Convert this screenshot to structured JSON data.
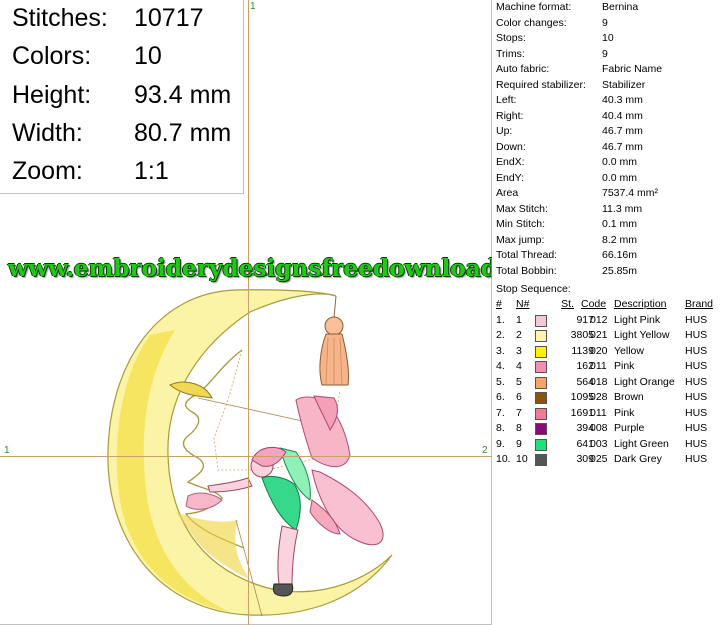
{
  "stats": [
    {
      "label": "Stitches:",
      "value": "10717"
    },
    {
      "label": "Colors:",
      "value": "10"
    },
    {
      "label": "Height:",
      "value": "93.4 mm"
    },
    {
      "label": "Width:",
      "value": "80.7 mm"
    },
    {
      "label": "Zoom:",
      "value": "1:1"
    }
  ],
  "guides": {
    "h_left": "1",
    "h_right": "2",
    "v_top": "1"
  },
  "watermark": "www.embroiderydesignsfreedownload.com",
  "info": [
    {
      "key": "Machine format:",
      "value": "Bernina"
    },
    {
      "key": "Color changes:",
      "value": "9"
    },
    {
      "key": "Stops:",
      "value": "10"
    },
    {
      "key": "Trims:",
      "value": "9"
    },
    {
      "key": "Auto fabric:",
      "value": "Fabric Name"
    },
    {
      "key": "Required stabilizer:",
      "value": "Stabilizer"
    },
    {
      "key": "Left:",
      "value": "40.3 mm"
    },
    {
      "key": "Right:",
      "value": "40.4 mm"
    },
    {
      "key": "Up:",
      "value": "46.7 mm"
    },
    {
      "key": "Down:",
      "value": "46.7 mm"
    },
    {
      "key": "EndX:",
      "value": "0.0 mm"
    },
    {
      "key": "EndY:",
      "value": "0.0 mm"
    },
    {
      "key": "Area",
      "value": "7537.4 mm²"
    },
    {
      "key": "Max Stitch:",
      "value": "11.3 mm"
    },
    {
      "key": "Min Stitch:",
      "value": "0.1 mm"
    },
    {
      "key": "Max jump:",
      "value": "8.2 mm"
    },
    {
      "key": "Total Thread:",
      "value": "66.16m"
    },
    {
      "key": "Total Bobbin:",
      "value": "25.85m"
    }
  ],
  "stop_sequence_label": "Stop Sequence:",
  "table_headers": {
    "num": "#",
    "n": "N#",
    "st": "St.",
    "code": "Code",
    "desc": "Description",
    "brand": "Brand"
  },
  "colors": [
    {
      "num": "1.",
      "n": "1",
      "swatch": "#f6c6d6",
      "st": "917",
      "code": "012",
      "desc": "Light Pink",
      "brand": "HUS"
    },
    {
      "num": "2.",
      "n": "2",
      "swatch": "#fbf5b0",
      "st": "3805",
      "code": "021",
      "desc": "Light Yellow",
      "brand": "HUS"
    },
    {
      "num": "3.",
      "n": "3",
      "swatch": "#fff200",
      "st": "1139",
      "code": "020",
      "desc": "Yellow",
      "brand": "HUS"
    },
    {
      "num": "4.",
      "n": "4",
      "swatch": "#f58fb0",
      "st": "162",
      "code": "011",
      "desc": "Pink",
      "brand": "HUS"
    },
    {
      "num": "5.",
      "n": "5",
      "swatch": "#f7a46a",
      "st": "564",
      "code": "018",
      "desc": "Light Orange",
      "brand": "HUS"
    },
    {
      "num": "6.",
      "n": "6",
      "swatch": "#8a5410",
      "st": "1095",
      "code": "028",
      "desc": "Brown",
      "brand": "HUS"
    },
    {
      "num": "7.",
      "n": "7",
      "swatch": "#f07a98",
      "st": "1691",
      "code": "011",
      "desc": "Pink",
      "brand": "HUS"
    },
    {
      "num": "8.",
      "n": "8",
      "swatch": "#8a0a7a",
      "st": "394",
      "code": "008",
      "desc": "Purple",
      "brand": "HUS"
    },
    {
      "num": "9.",
      "n": "9",
      "swatch": "#1fe07a",
      "st": "641",
      "code": "003",
      "desc": "Light Green",
      "brand": "HUS"
    },
    {
      "num": "10.",
      "n": "10",
      "swatch": "#555555",
      "st": "309",
      "code": "025",
      "desc": "Dark Grey",
      "brand": "HUS"
    }
  ]
}
